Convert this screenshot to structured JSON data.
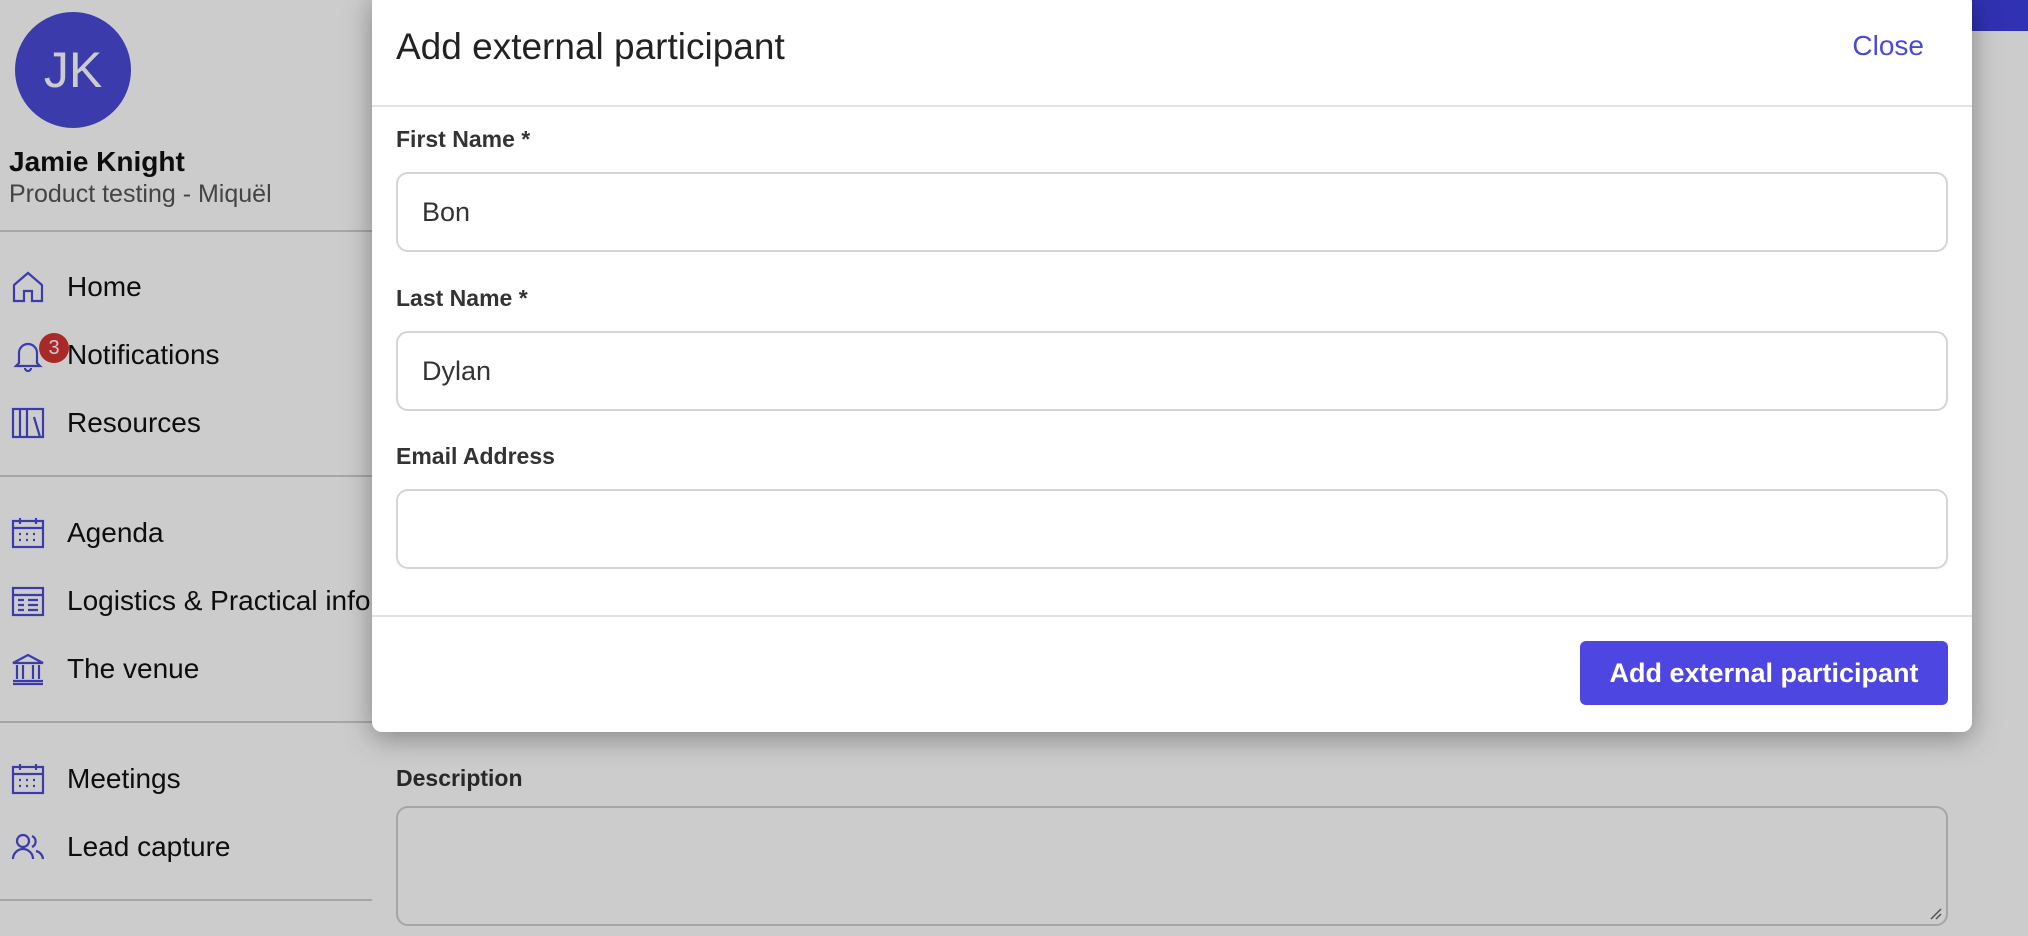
{
  "user": {
    "initials": "JK",
    "name": "Jamie Knight",
    "org": "Product testing - Miquël"
  },
  "sidebar": {
    "items": [
      {
        "label": "Home",
        "icon": "home-icon"
      },
      {
        "label": "Notifications",
        "icon": "bell-icon",
        "badge": "3"
      },
      {
        "label": "Resources",
        "icon": "books-icon"
      },
      {
        "label": "Agenda",
        "icon": "calendar-icon"
      },
      {
        "label": "Logistics & Practical info",
        "icon": "list-calendar-icon"
      },
      {
        "label": "The venue",
        "icon": "building-icon"
      },
      {
        "label": "Meetings",
        "icon": "calendar-icon"
      },
      {
        "label": "Lead capture",
        "icon": "users-icon"
      }
    ]
  },
  "background_form": {
    "description_label": "Description",
    "description_value": ""
  },
  "modal": {
    "title": "Add external participant",
    "close_label": "Close",
    "fields": {
      "first_name": {
        "label": "First Name *",
        "value": "Bon"
      },
      "last_name": {
        "label": "Last Name *",
        "value": "Dylan"
      },
      "email": {
        "label": "Email Address",
        "value": ""
      }
    },
    "submit_label": "Add external participant"
  },
  "colors": {
    "accent": "#4e46e0",
    "badge": "#d43232",
    "topbar_start": "#6a2fc0",
    "topbar_end": "#3b3fe0"
  }
}
